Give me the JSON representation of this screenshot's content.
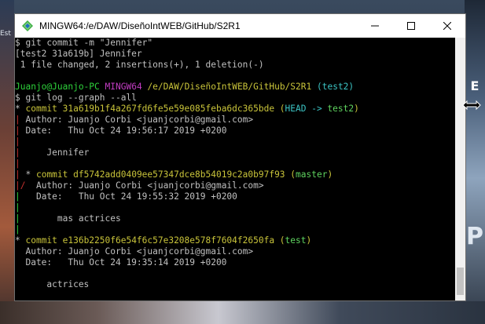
{
  "window": {
    "title": "MINGW64:/e/DAW/DiseñoIntWEB/GitHub/S2R1",
    "buttons": {
      "minimize": "minimize-icon",
      "maximize": "maximize-icon",
      "close": "close-icon"
    }
  },
  "desktop": {
    "left_text": "Est",
    "right_text_1": "E",
    "right_text_2": "P"
  },
  "colors": {
    "prompt_user": "#2ed33b",
    "prompt_env": "#c33dc3",
    "prompt_path": "#c9c43a",
    "prompt_branch": "#3bc3c3",
    "commit_hash": "#c9c43a",
    "graph_red": "#c5302f",
    "graph_green": "#2ed33b"
  },
  "terminal": {
    "lines": [
      {
        "segments": [
          {
            "text": "$ git commit -m \"Jennifer\"",
            "color": "white"
          }
        ]
      },
      {
        "segments": [
          {
            "text": "[test2 31a619b] Jennifer",
            "color": "white"
          }
        ]
      },
      {
        "segments": [
          {
            "text": " 1 file changed, 2 insertions(+), 1 deletion(-)",
            "color": "white"
          }
        ]
      },
      {
        "segments": [
          {
            "text": "",
            "color": "white"
          }
        ]
      },
      {
        "segments": [
          {
            "text": "Juanjo@Juanjo-PC",
            "color": "green"
          },
          {
            "text": " ",
            "color": "white"
          },
          {
            "text": "MINGW64",
            "color": "magenta"
          },
          {
            "text": " ",
            "color": "white"
          },
          {
            "text": "/e/DAW/DiseñoIntWEB/GitHub/S2R1",
            "color": "yellow"
          },
          {
            "text": " ",
            "color": "white"
          },
          {
            "text": "(test2)",
            "color": "cyan"
          }
        ]
      },
      {
        "segments": [
          {
            "text": "$ git log --graph --all",
            "color": "white"
          }
        ]
      },
      {
        "segments": [
          {
            "text": "* ",
            "color": "white"
          },
          {
            "text": "commit 31a619b1f4a267fd6fe5e59e085feba6dc365bde",
            "color": "yellow"
          },
          {
            "text": " (",
            "color": "yellow"
          },
          {
            "text": "HEAD -> ",
            "color": "cyan"
          },
          {
            "text": "test2",
            "color": "lgreen"
          },
          {
            "text": ")",
            "color": "yellow"
          }
        ]
      },
      {
        "segments": [
          {
            "text": "| ",
            "color": "red"
          },
          {
            "text": "Author: Juanjo Corbi <juanjcorbi@gmail.com>",
            "color": "white"
          }
        ]
      },
      {
        "segments": [
          {
            "text": "| ",
            "color": "red"
          },
          {
            "text": "Date:   Thu Oct 24 19:56:17 2019 +0200",
            "color": "white"
          }
        ]
      },
      {
        "segments": [
          {
            "text": "|",
            "color": "red"
          }
        ]
      },
      {
        "segments": [
          {
            "text": "| ",
            "color": "red"
          },
          {
            "text": "    Jennifer",
            "color": "white"
          }
        ]
      },
      {
        "segments": [
          {
            "text": "|",
            "color": "red"
          }
        ]
      },
      {
        "segments": [
          {
            "text": "| ",
            "color": "red"
          },
          {
            "text": "* ",
            "color": "white"
          },
          {
            "text": "commit df5742add0409ee57347dce8b54019c2a0b97f93",
            "color": "yellow"
          },
          {
            "text": " (",
            "color": "yellow"
          },
          {
            "text": "master",
            "color": "lgreen"
          },
          {
            "text": ")",
            "color": "yellow"
          }
        ]
      },
      {
        "segments": [
          {
            "text": "|/ ",
            "color": "red"
          },
          {
            "text": " Author: Juanjo Corbi <juanjcorbi@gmail.com>",
            "color": "white"
          }
        ]
      },
      {
        "segments": [
          {
            "text": "|  ",
            "color": "green"
          },
          {
            "text": " Date:   Thu Oct 24 19:55:32 2019 +0200",
            "color": "white"
          }
        ]
      },
      {
        "segments": [
          {
            "text": "|",
            "color": "green"
          }
        ]
      },
      {
        "segments": [
          {
            "text": "|  ",
            "color": "green"
          },
          {
            "text": "     mas actrices",
            "color": "white"
          }
        ]
      },
      {
        "segments": [
          {
            "text": "|",
            "color": "green"
          }
        ]
      },
      {
        "segments": [
          {
            "text": "* ",
            "color": "white"
          },
          {
            "text": "commit e136b2250f6e54f6c57e3208e578f7604f2650fa",
            "color": "yellow"
          },
          {
            "text": " (",
            "color": "yellow"
          },
          {
            "text": "test",
            "color": "lgreen"
          },
          {
            "text": ")",
            "color": "yellow"
          }
        ]
      },
      {
        "segments": [
          {
            "text": "  Author: Juanjo Corbi <juanjcorbi@gmail.com>",
            "color": "white"
          }
        ]
      },
      {
        "segments": [
          {
            "text": "  Date:   Thu Oct 24 19:35:14 2019 +0200",
            "color": "white"
          }
        ]
      },
      {
        "segments": [
          {
            "text": "",
            "color": "white"
          }
        ]
      },
      {
        "segments": [
          {
            "text": "      actrices",
            "color": "white"
          }
        ]
      },
      {
        "segments": [
          {
            "text": "",
            "color": "white"
          }
        ]
      }
    ]
  }
}
